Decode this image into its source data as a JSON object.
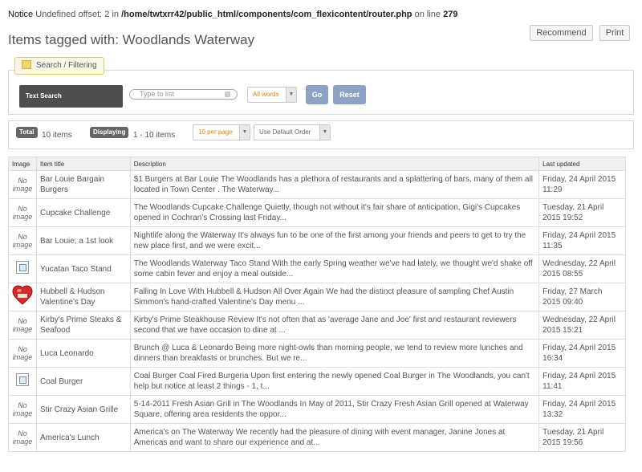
{
  "notice": {
    "label": "Notice",
    "message_start": "Undefined offset: 2 in",
    "path": "/home/twtxrr42/public_html/components/com_flexicontent/router.php",
    "message_mid": "on line",
    "line": "279"
  },
  "page": {
    "title": "Items tagged with: Woodlands Waterway",
    "recommend_label": "Recommend",
    "print_label": "Print"
  },
  "search": {
    "tab_label": "Search / Filtering",
    "text_search_label": "Text Search",
    "input_placeholder": "Type to list",
    "words_select": "All words",
    "go_label": "Go",
    "reset_label": "Reset"
  },
  "counts": {
    "total_label": "Total",
    "total_value": "10 items",
    "displaying_label": "Displaying",
    "displaying_value": "1 - 10 items",
    "per_page": "10 per page",
    "order": "Use Default Order"
  },
  "table": {
    "headers": {
      "image": "Image",
      "title": "Item title",
      "description": "Description",
      "updated": "Last updated"
    },
    "rows": [
      {
        "image_text": "No image",
        "title": "Bar Louie Bargain Burgers",
        "description": "$1 Burgers at Bar Louie The Woodlands has a plethora of restaurants and a splattering of bars, many of them all located in Town Center . The Waterway...",
        "date": "Friday, 24 April 2015 11:29"
      },
      {
        "image_text": "No image",
        "title": "Cupcake Challenge",
        "description": "The Woodlands Cupcake Challenge Quietly, though not without it's fair share of anticipation, Gigi's Cupcakes opened in Cochran's Crossing last Friday...",
        "date": "Tuesday, 21 April 2015 19:52"
      },
      {
        "image_text": "No image",
        "title": "Bar Louie; a 1st look",
        "description": "Nightlife along the Waterway It's always fun to be one of the first among your friends and peers to get to try the new place first, and we were excit...",
        "date": "Friday, 24 April 2015 11:35"
      },
      {
        "image_text": "",
        "title": "Yucatan Taco Stand",
        "description": "The Woodlands Waterway Taco Stand With the early Spring weather we've had lately, we thought we'd shake off some cabin fever and enjoy a meal outside...",
        "date": "Wednesday, 22 April 2015 08:55"
      },
      {
        "image_text": "",
        "title": "Hubbell & Hudson Valentine's Day",
        "description": "Falling In Love With Hubbell & Hudson All Over Again We had the distinct pleasure of sampling Chef Austin Simmon's hand-crafted Valentine's Day menu ...",
        "date": "Friday, 27 March 2015 09:40"
      },
      {
        "image_text": "No image",
        "title": "Kirby's Prime Steaks & Seafood",
        "description": "Kirby's Prime Steakhouse Review It's not often that as 'average Jane and Joe' first and restaurant reviewers second that we have occasion to dine at ...",
        "date": "Wednesday, 22 April 2015 15:21"
      },
      {
        "image_text": "No image",
        "title": "Luca Leonardo",
        "description": "Brunch @ Luca & Leonardo Being more night-owls than morning people, we tend to review more lunches and dinners than breakfasts or brunches. But we re...",
        "date": "Friday, 24 April 2015 16:34"
      },
      {
        "image_text": "",
        "title": "Coal Burger",
        "description": "Coal Burger Coal Fired Burgeria Upon first entering the newly opened Coal Burger in The Woodlands, you can't help but notice at least 2 things - 1, t...",
        "date": "Friday, 24 April 2015 11:41"
      },
      {
        "image_text": "No image",
        "title": "Stir Crazy Asian Grille",
        "description": "5-14-2011 Fresh Asian Grill in The Woodlands In May of 2011, Stir Crazy Fresh Asian Grill opened at Waterway Square, offering area residents the oppor...",
        "date": "Friday, 24 April 2015 13:32"
      },
      {
        "image_text": "No image",
        "title": "America's Lunch",
        "description": "America's on The Waterway We recently had the pleasure of dining with event manager, Janine Jones at Americas and want to share our experience and at...",
        "date": "Tuesday, 21 April 2015 19:56"
      }
    ]
  },
  "icons": {
    "tab": "calendar-icon",
    "broken": "broken-image-icon",
    "heart": "heart-image-icon"
  },
  "colors": {
    "accent_orange": "#e08a00",
    "button_blue": "#8ea2c6",
    "dark_label": "#4e4e4e"
  }
}
